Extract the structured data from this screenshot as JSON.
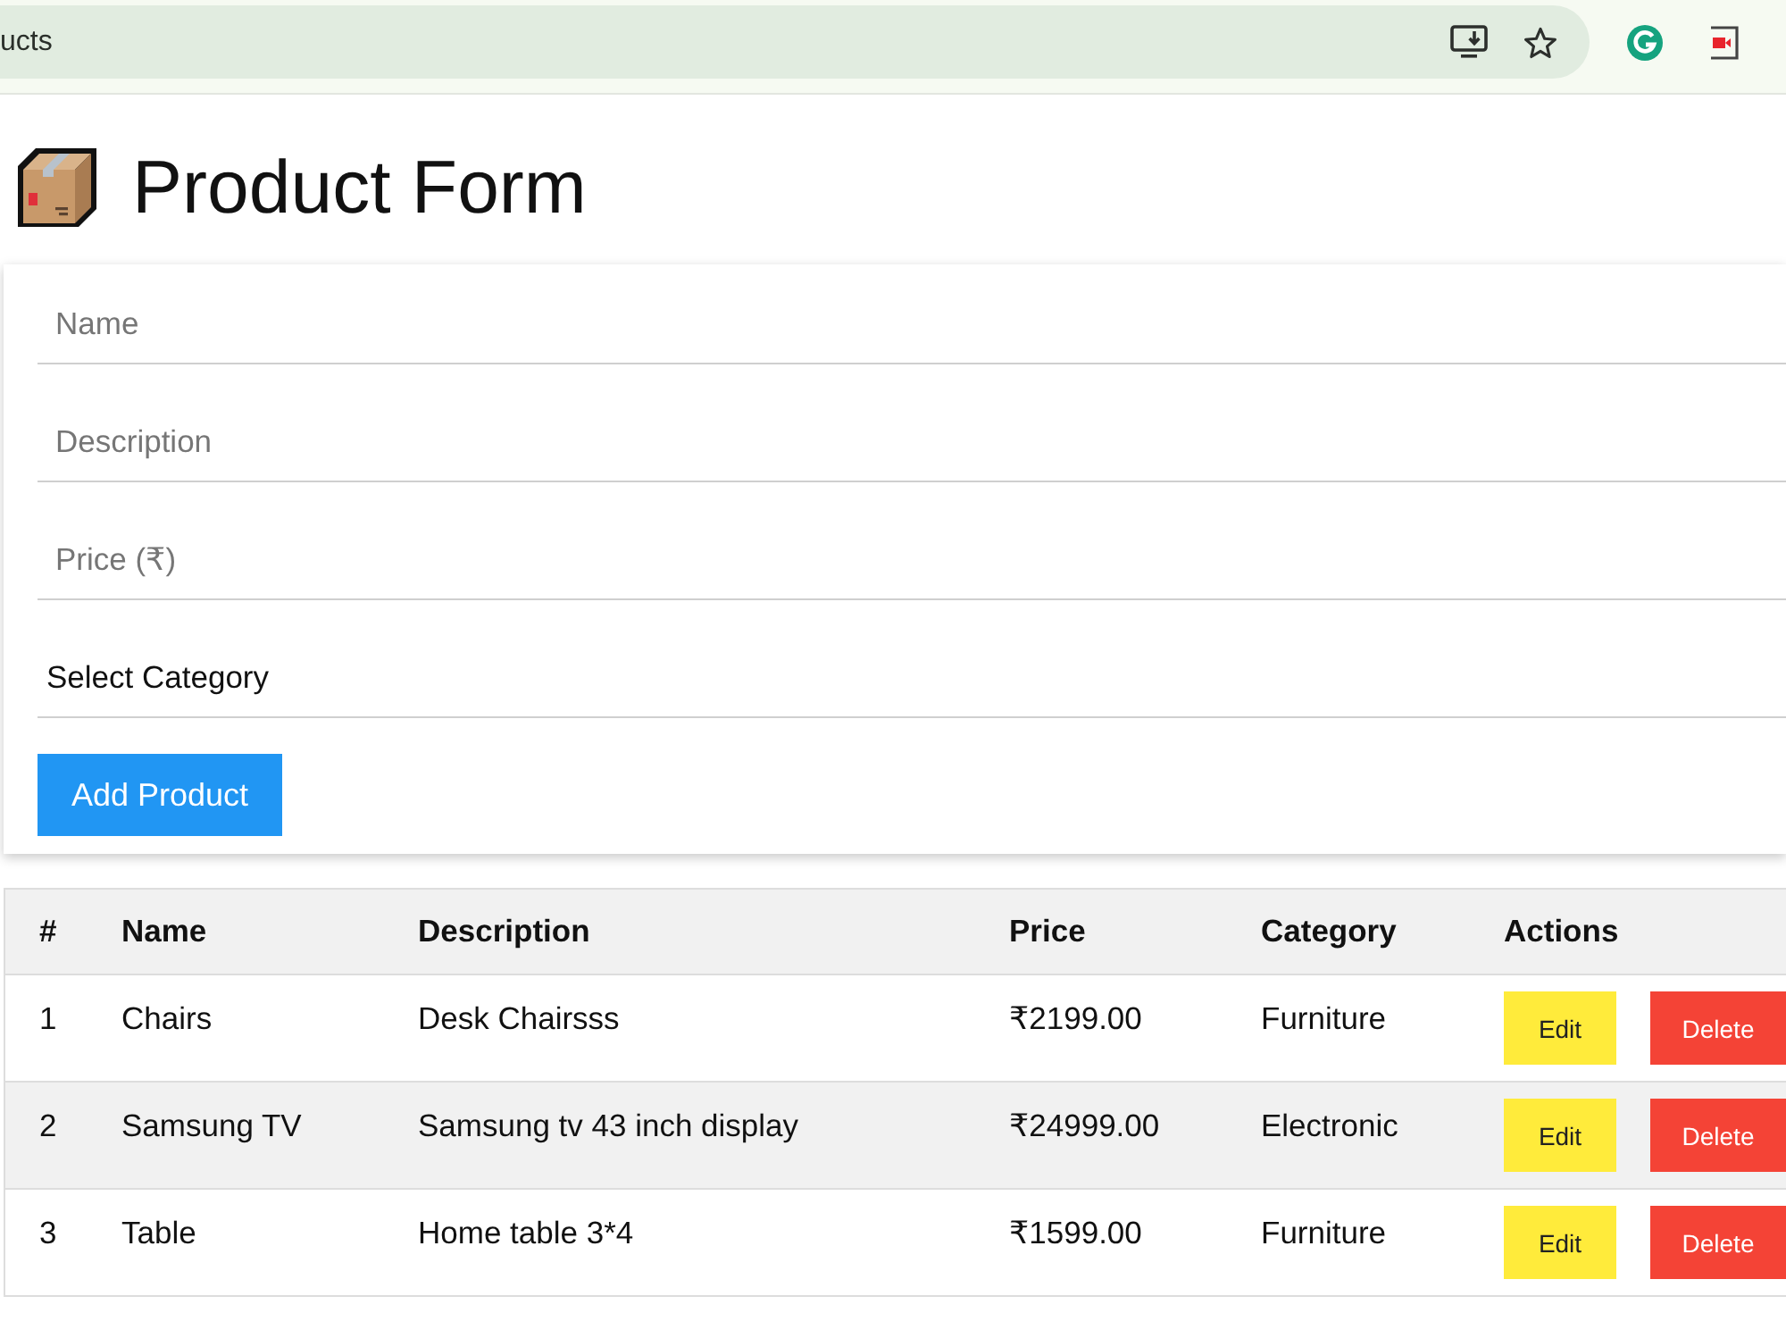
{
  "browser": {
    "address": "ucts"
  },
  "page": {
    "title": "Product Form"
  },
  "form": {
    "fields": [
      {
        "kind": "input",
        "placeholder": "Name"
      },
      {
        "kind": "input",
        "placeholder": "Description"
      },
      {
        "kind": "input",
        "placeholder": "Price (₹)"
      },
      {
        "kind": "select",
        "value": "Select Category"
      }
    ],
    "submit_button": "Add Product"
  },
  "table": {
    "columns": [
      "#",
      "Name",
      "Description",
      "Price",
      "Category",
      "Actions"
    ],
    "rows": [
      {
        "cells": [
          "1",
          "Chairs",
          "Desk Chairsss",
          "₹2199.00",
          "Furniture"
        ],
        "actions": [
          {
            "kind": "edit",
            "label": "Edit"
          },
          {
            "kind": "delete",
            "label": "Delete"
          }
        ]
      },
      {
        "cells": [
          "2",
          "Samsung TV",
          "Samsung tv 43 inch display",
          "₹24999.00",
          "Electronic"
        ],
        "actions": [
          {
            "kind": "edit",
            "label": "Edit"
          },
          {
            "kind": "delete",
            "label": "Delete"
          }
        ]
      },
      {
        "cells": [
          "3",
          "Table",
          "Home table 3*4",
          "₹1599.00",
          "Furniture"
        ],
        "actions": [
          {
            "kind": "edit",
            "label": "Edit"
          },
          {
            "kind": "delete",
            "label": "Delete"
          }
        ]
      }
    ]
  }
}
